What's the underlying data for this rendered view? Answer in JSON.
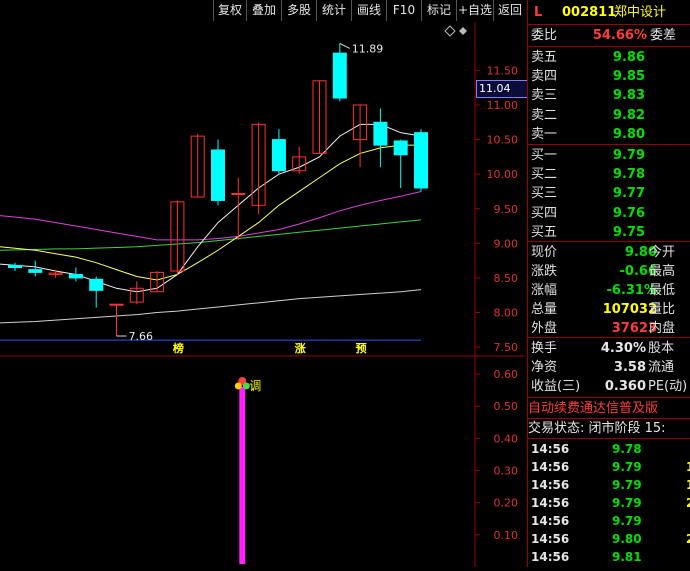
{
  "toolbar": {
    "buttons": [
      "复权",
      "叠加",
      "多股",
      "统计",
      "画线",
      "F10",
      "标记",
      "+自选",
      "返回"
    ]
  },
  "chart_data": {
    "type": "candlestick",
    "price_axis": {
      "ticks": [
        "11.50",
        "11.00",
        "10.50",
        "10.00",
        "9.50",
        "9.00",
        "8.50",
        "8.00",
        "7.50"
      ],
      "min": 7.4,
      "max": 12.2
    },
    "current_price_label": "11.04",
    "high_label": "11.89",
    "low_label": "7.66",
    "candles": [
      {
        "o": 8.68,
        "c": 8.65,
        "h": 8.72,
        "l": 8.6
      },
      {
        "o": 8.62,
        "c": 8.58,
        "h": 8.75,
        "l": 8.52
      },
      {
        "o": 8.55,
        "c": 8.57,
        "h": 8.62,
        "l": 8.5
      },
      {
        "o": 8.55,
        "c": 8.5,
        "h": 8.65,
        "l": 8.45
      },
      {
        "o": 8.48,
        "c": 8.32,
        "h": 8.52,
        "l": 8.07
      },
      {
        "o": 8.12,
        "c": 8.12,
        "h": 8.12,
        "l": 7.66
      },
      {
        "o": 8.15,
        "c": 8.35,
        "h": 8.45,
        "l": 8.12
      },
      {
        "o": 8.3,
        "c": 8.58,
        "h": 8.6,
        "l": 8.3
      },
      {
        "o": 8.6,
        "c": 9.6,
        "h": 9.62,
        "l": 8.55
      },
      {
        "o": 9.67,
        "c": 10.55,
        "h": 10.58,
        "l": 9.67
      },
      {
        "o": 10.35,
        "c": 9.62,
        "h": 10.5,
        "l": 9.55
      },
      {
        "o": 9.72,
        "c": 9.72,
        "h": 9.95,
        "l": 9.05
      },
      {
        "o": 9.55,
        "c": 10.72,
        "h": 10.75,
        "l": 9.42
      },
      {
        "o": 10.5,
        "c": 10.05,
        "h": 10.65,
        "l": 10.0
      },
      {
        "o": 10.05,
        "c": 10.25,
        "h": 10.4,
        "l": 10.0
      },
      {
        "o": 10.3,
        "c": 11.35,
        "h": 11.35,
        "l": 10.3
      },
      {
        "o": 11.75,
        "c": 11.1,
        "h": 11.89,
        "l": 11.05
      },
      {
        "o": 10.5,
        "c": 11.0,
        "h": 11.0,
        "l": 10.1
      },
      {
        "o": 10.75,
        "c": 10.42,
        "h": 10.95,
        "l": 10.1
      },
      {
        "o": 10.48,
        "c": 10.28,
        "h": 10.5,
        "l": 9.8
      },
      {
        "o": 10.6,
        "c": 9.8,
        "h": 10.65,
        "l": 9.75
      }
    ],
    "ma_white": [
      8.7,
      8.66,
      8.6,
      8.55,
      8.45,
      8.35,
      8.3,
      8.35,
      8.55,
      8.95,
      9.3,
      9.55,
      9.8,
      10.0,
      10.1,
      10.25,
      10.55,
      10.72,
      10.72,
      10.6,
      10.55
    ],
    "ma_yellow": [
      8.95,
      8.9,
      8.85,
      8.8,
      8.72,
      8.62,
      8.52,
      8.47,
      8.55,
      8.72,
      8.9,
      9.1,
      9.3,
      9.55,
      9.75,
      9.95,
      10.15,
      10.3,
      10.38,
      10.42,
      10.42
    ],
    "ma_magenta": [
      9.4,
      9.35,
      9.3,
      9.25,
      9.2,
      9.15,
      9.1,
      9.05,
      9.05,
      9.05,
      9.07,
      9.1,
      9.15,
      9.2,
      9.28,
      9.37,
      9.47,
      9.55,
      9.62,
      9.68,
      9.75
    ],
    "ma_green": [
      8.9,
      8.91,
      8.92,
      8.92,
      8.93,
      8.94,
      8.95,
      8.97,
      8.99,
      9.01,
      9.04,
      9.07,
      9.1,
      9.13,
      9.16,
      9.19,
      9.22,
      9.25,
      9.28,
      9.31,
      9.34
    ],
    "ma_gray": [
      7.85,
      7.87,
      7.89,
      7.91,
      7.93,
      7.95,
      7.97,
      8.0,
      8.02,
      8.05,
      8.08,
      8.11,
      8.14,
      8.17,
      8.2,
      8.22,
      8.24,
      8.26,
      8.28,
      8.3,
      8.33
    ],
    "ma_blue": [
      7.6,
      7.6,
      7.6,
      7.6,
      7.6,
      7.6,
      7.6,
      7.6,
      7.6,
      7.6,
      7.6,
      7.6,
      7.6,
      7.6,
      7.6,
      7.6,
      7.6,
      7.6,
      7.6,
      7.6,
      7.6
    ],
    "markers": [
      {
        "label": "榜",
        "index": 8
      },
      {
        "label": "涨",
        "index": 14
      },
      {
        "label": "预",
        "index": 17
      }
    ],
    "indicator": {
      "ticks": [
        "0.60",
        "0.50",
        "0.40",
        "0.30",
        "0.20",
        "0.10"
      ],
      "min": 0.0,
      "max": 0.65,
      "bar_index": 11,
      "bar_value": 0.56,
      "annotation": "调"
    }
  },
  "colors": {
    "up": "#ff3030",
    "down": "#00ffff",
    "panel_border": "#9a0000"
  },
  "panel": {
    "market_flag": "L",
    "code": "002811",
    "name": "郑中设计",
    "weibi_label": "委比",
    "weibi_value": "54.66%",
    "weicha_label": "委差",
    "asks": [
      {
        "label": "卖五",
        "price": "9.86"
      },
      {
        "label": "卖四",
        "price": "9.85"
      },
      {
        "label": "卖三",
        "price": "9.83"
      },
      {
        "label": "卖二",
        "price": "9.82"
      },
      {
        "label": "卖一",
        "price": "9.80"
      }
    ],
    "bids": [
      {
        "label": "买一",
        "price": "9.79"
      },
      {
        "label": "买二",
        "price": "9.78"
      },
      {
        "label": "买三",
        "price": "9.77"
      },
      {
        "label": "买四",
        "price": "9.76"
      },
      {
        "label": "买五",
        "price": "9.75"
      }
    ],
    "quote": [
      {
        "label": "现价",
        "value": "9.80",
        "label2": "今开",
        "color": "green"
      },
      {
        "label": "涨跌",
        "value": "-0.66",
        "label2": "最高",
        "color": "green"
      },
      {
        "label": "涨幅",
        "value": "-6.31%",
        "label2": "最低",
        "color": "green"
      },
      {
        "label": "总量",
        "value": "107032",
        "label2": "量比",
        "color": "yellow"
      },
      {
        "label": "外盘",
        "value": "37623",
        "label2": "内盘",
        "color": "red"
      }
    ],
    "finance": [
      {
        "label": "换手",
        "value": "4.30%",
        "label2": "股本"
      },
      {
        "label": "净资",
        "value": "3.58",
        "label2": "流通"
      },
      {
        "label": "收益(三)",
        "value": "0.360",
        "label2": "PE(动)"
      }
    ],
    "auto_renew": "自动续费通达信普及版",
    "trade_status": "交易状态: 闭市阶段 15:",
    "ticks": [
      {
        "time": "14:56",
        "price": "9.78",
        "vol": ""
      },
      {
        "time": "14:56",
        "price": "9.79",
        "vol": "1"
      },
      {
        "time": "14:56",
        "price": "9.79",
        "vol": "1"
      },
      {
        "time": "14:56",
        "price": "9.79",
        "vol": "2"
      },
      {
        "time": "14:56",
        "price": "9.79",
        "vol": ""
      },
      {
        "time": "14:56",
        "price": "9.80",
        "vol": "2"
      },
      {
        "time": "14:56",
        "price": "9.81",
        "vol": ""
      }
    ]
  }
}
